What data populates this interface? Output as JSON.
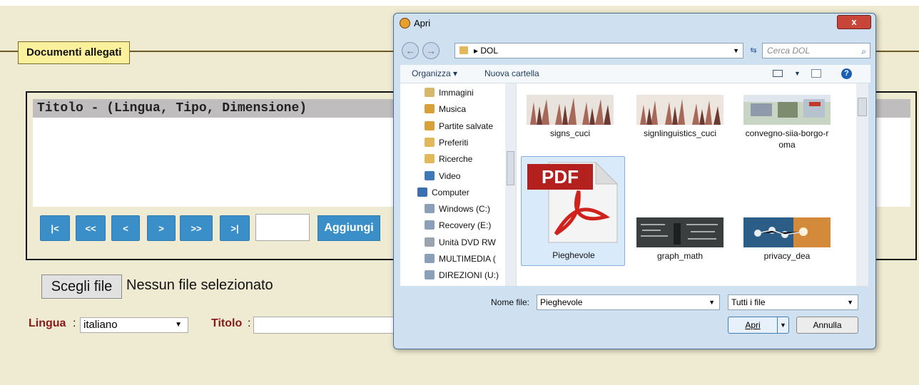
{
  "page": {
    "section_title": "Documenti allegati",
    "table_header": "Titolo - (Lingua, Tipo, Dimensione)",
    "pager": {
      "first": "|<",
      "prev_page": "<<",
      "prev": "<",
      "next": ">",
      "next_page": ">>",
      "last": ">|",
      "page_value": ""
    },
    "add_label": "Aggiungi",
    "choose_file_label": "Scegli file",
    "choose_file_status": "Nessun file selezionato",
    "lingua_label": "Lingua",
    "lingua_value": "italiano",
    "titolo_label": "Titolo",
    "colon": ":"
  },
  "dialog": {
    "title": "Apri",
    "close": "x",
    "path": "DOL",
    "search_placeholder": "Cerca DOL",
    "toolbar": {
      "organize": "Organizza ▾",
      "new_folder": "Nuova cartella",
      "help": "?"
    },
    "tree": [
      {
        "label": "Immagini",
        "icon": "pictures-folder-icon"
      },
      {
        "label": "Musica",
        "icon": "music-folder-icon"
      },
      {
        "label": "Partite salvate",
        "icon": "saved-games-folder-icon"
      },
      {
        "label": "Preferiti",
        "icon": "favorites-folder-icon"
      },
      {
        "label": "Ricerche",
        "icon": "searches-folder-icon"
      },
      {
        "label": "Video",
        "icon": "video-folder-icon"
      },
      {
        "label": "Computer",
        "icon": "computer-icon"
      },
      {
        "label": "Windows (C:)",
        "icon": "drive-icon"
      },
      {
        "label": "Recovery (E:)",
        "icon": "drive-icon"
      },
      {
        "label": "Unità DVD RW",
        "icon": "dvd-drive-icon"
      },
      {
        "label": "MULTIMEDIA (",
        "icon": "network-drive-icon"
      },
      {
        "label": "DIREZIONI (U:)",
        "icon": "network-drive-icon"
      }
    ],
    "files": [
      {
        "name": "signs_cuci",
        "icon": "hands-photo-thumbnail"
      },
      {
        "name": "signlinguistics_cuci",
        "icon": "hands-photo-thumbnail"
      },
      {
        "name": "convegno-siia-borgo-r",
        "name2": "oma",
        "icon": "conference-photo-thumbnail"
      },
      {
        "name": "Pieghevole",
        "icon": "pdf-file-icon",
        "selected": true
      },
      {
        "name": "graph_math",
        "icon": "math-blackboard-thumbnail"
      },
      {
        "name": "privacy_dea",
        "icon": "network-photo-thumbnail"
      }
    ],
    "pdf_badge": "PDF",
    "filename_label": "Nome file:",
    "filename_value": "Pieghevole",
    "filetype_value": "Tutti i file",
    "open_label": "Apri",
    "cancel_label": "Annulla"
  }
}
